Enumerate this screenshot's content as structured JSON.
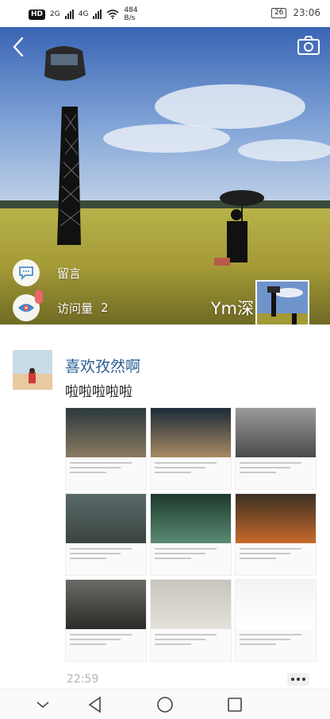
{
  "status_bar": {
    "hd": "HD",
    "net1": "2G",
    "net2": "4G",
    "speed_value": "484",
    "speed_unit": "B/s",
    "battery": "26",
    "time": "23:06"
  },
  "header": {
    "back_icon": "chevron-left-icon",
    "camera_icon": "camera-icon"
  },
  "hero": {
    "message_label": "留言",
    "visits_label": "访问量",
    "visits_count": "2",
    "username": "Ym深"
  },
  "post": {
    "author": "喜欢孜然啊",
    "text": "啦啦啦啦啦",
    "time": "22:59"
  },
  "grid_images": [
    {
      "id": 1,
      "top": "#2c3a3f",
      "bottom": "#8a7a60"
    },
    {
      "id": 2,
      "top": "#1d2a3a",
      "bottom": "#a88a62"
    },
    {
      "id": 3,
      "top": "#9a9a9a",
      "bottom": "#4a4a4a"
    },
    {
      "id": 4,
      "top": "#5a6a6a",
      "bottom": "#3a4440"
    },
    {
      "id": 5,
      "top": "#1d3a2c",
      "bottom": "#5a8a74"
    },
    {
      "id": 6,
      "top": "#3a3024",
      "bottom": "#c86a2a"
    },
    {
      "id": 7,
      "top": "#6a6a66",
      "bottom": "#2a2a28"
    },
    {
      "id": 8,
      "top": "#c8c4be",
      "bottom": "#e4e0da"
    },
    {
      "id": 9,
      "top": "#f4f4f4",
      "bottom": "#ffffff"
    }
  ],
  "colors": {
    "author": "#2a5d92",
    "badge": "#e8666e",
    "time": "#b4b4b4"
  },
  "nav": {
    "down_icon": "chevron-down-icon",
    "back_icon": "triangle-back-icon",
    "home_icon": "circle-home-icon",
    "recent_icon": "square-recent-icon"
  }
}
